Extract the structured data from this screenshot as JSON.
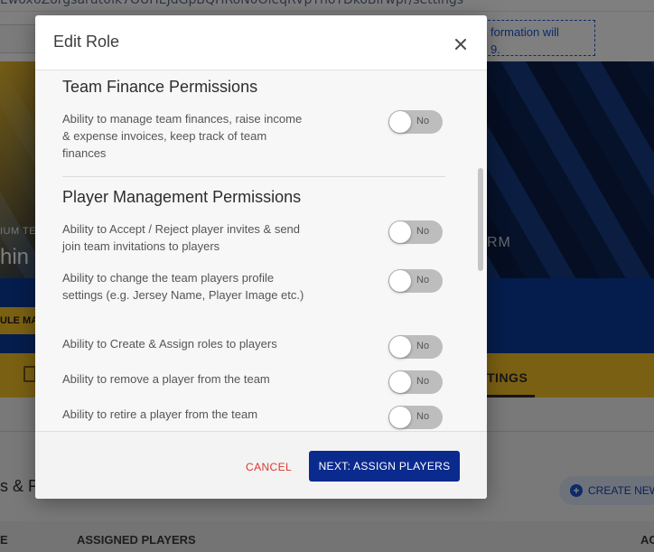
{
  "background": {
    "url_fragment": "Ewox6Zorgsarut0ik7OUHEJdGpBQHRoN0OleqRVpTnoTDkoBIrwpr/settings",
    "info_text": "formation will\n9.",
    "hero_small_text": "IUM TE",
    "hero_name": "hin",
    "hero_right": "RM",
    "yellow_button": "ULE MA",
    "tab_settings": "TINGS",
    "roles_heading": "s & F",
    "create_button": "CREATE NEW",
    "table_headers": [
      "E",
      "ASSIGNED PLAYERS",
      "AC"
    ]
  },
  "modal": {
    "title": "Edit Role",
    "close_icon": "close-icon",
    "groups": [
      {
        "title": "Team Finance Permissions",
        "permissions": [
          {
            "text": "Ability to manage team finances, raise income & expense invoices, keep track of team finances",
            "toggle": "No"
          }
        ]
      },
      {
        "title": "Player Management Permissions",
        "permissions": [
          {
            "text": "Ability to Accept / Reject player invites & send join team invitations to players",
            "toggle": "No"
          },
          {
            "text": "Ability to change the team players profile settings (e.g. Jersey Name, Player Image etc.)",
            "toggle": "No"
          },
          {
            "text": "Ability to Create & Assign roles to players",
            "toggle": "No"
          },
          {
            "text": "Ability to remove a player from the team",
            "toggle": "No"
          },
          {
            "text": "Ability to retire a player from the team",
            "toggle": "No"
          }
        ]
      }
    ],
    "footer": {
      "cancel_label": "CANCEL",
      "next_label": "NEXT: ASSIGN PLAYERS"
    }
  },
  "colors": {
    "primary": "#0b2a8e",
    "accent_yellow": "#f5c025",
    "cancel_red": "#d93a2f",
    "toggle_off": "#bdbdbd"
  }
}
